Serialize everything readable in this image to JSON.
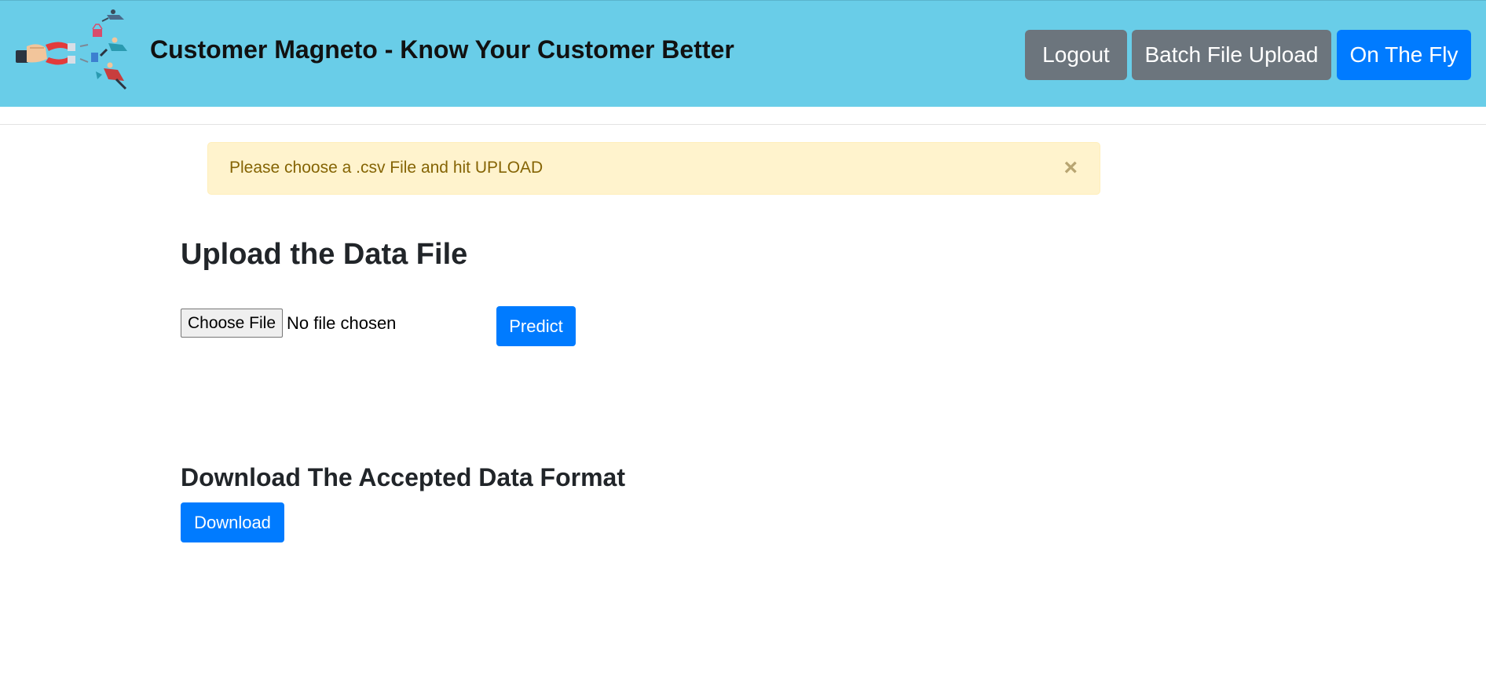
{
  "header": {
    "logo_icon": "magnet-attracting-customers-icon",
    "brand": "Customer Magneto - Know Your Customer Better",
    "nav": [
      {
        "label": "Logout",
        "style": "secondary",
        "color": "#6c757d"
      },
      {
        "label": "Batch File Upload",
        "style": "secondary",
        "color": "#6c757d"
      },
      {
        "label": "On The Fly",
        "style": "primary",
        "color": "#007bff"
      }
    ],
    "background_color": "#69cde8"
  },
  "alert": {
    "message": "Please choose a .csv File and hit UPLOAD",
    "close_symbol": "×",
    "close_icon": "close-icon"
  },
  "upload": {
    "heading": "Upload the Data File",
    "choose_file_label": "Choose File",
    "file_status": "No file chosen",
    "predict_label": "Predict"
  },
  "download": {
    "heading": "Download The Accepted Data Format",
    "button_label": "Download"
  },
  "colors": {
    "primary": "#007bff",
    "secondary": "#6c757d",
    "alert_bg": "#fff3cd",
    "alert_text": "#856404"
  }
}
